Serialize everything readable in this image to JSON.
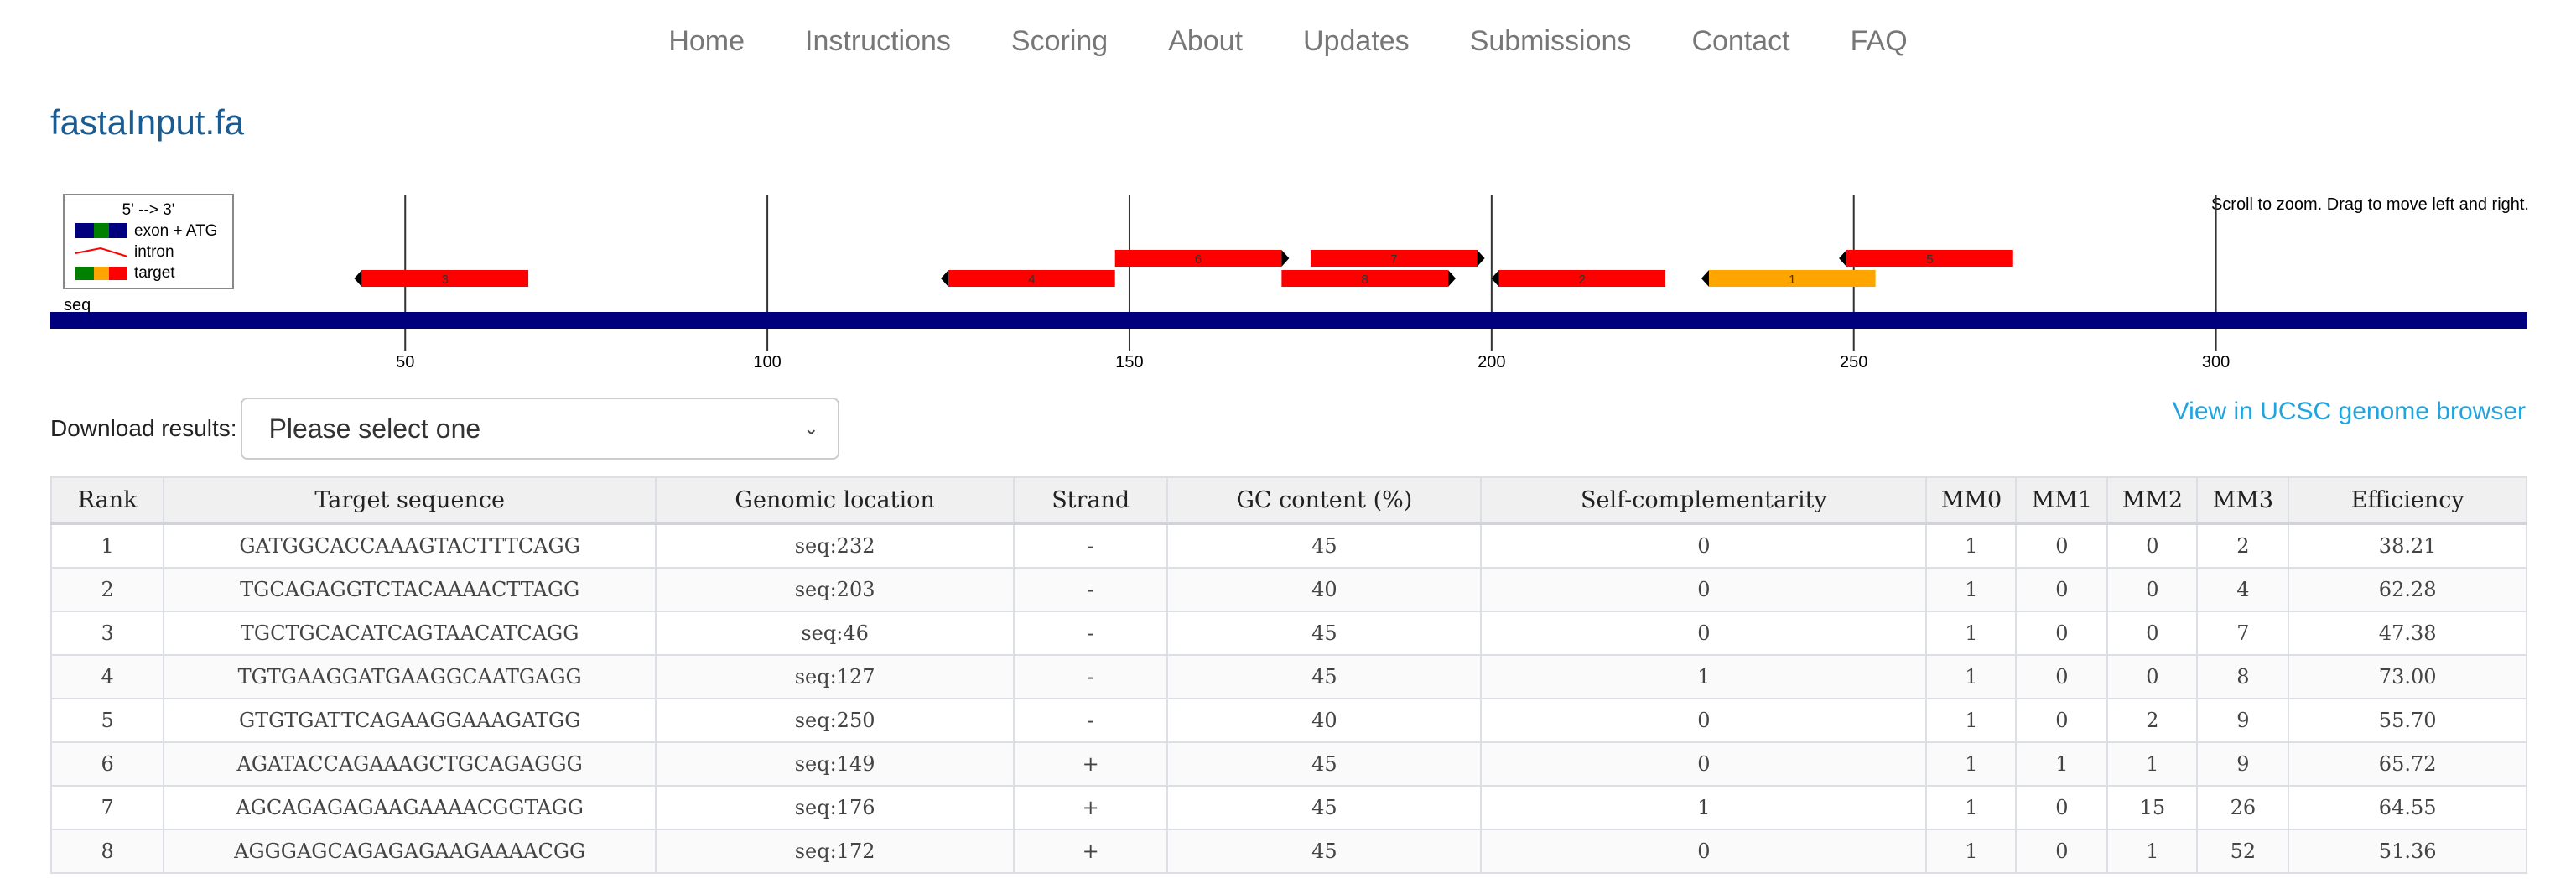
{
  "nav": {
    "items": [
      "Home",
      "Instructions",
      "Scoring",
      "About",
      "Updates",
      "Submissions",
      "Contact",
      "FAQ"
    ]
  },
  "page": {
    "title": "fastaInput.fa"
  },
  "viz": {
    "legend": {
      "direction": "5' --> 3'",
      "exon": "exon + ATG",
      "intron": "intron",
      "target": "target"
    },
    "hint": "Scroll to zoom. Drag to move left and right.",
    "sequence_label": "seq",
    "axis": {
      "min": 1,
      "max": 343,
      "ticks": [
        50,
        100,
        150,
        200,
        250,
        300
      ]
    },
    "colors": {
      "exon": "#00007f",
      "target_red": "#ff0000",
      "target_best": "#ffa500",
      "exon_green": "#008000",
      "legend_yellow": "#ffa500"
    },
    "targets": [
      {
        "label": "3",
        "start": 44,
        "end": 67,
        "strand": "-",
        "row": 1,
        "color": "#ff0000"
      },
      {
        "label": "4",
        "start": 125,
        "end": 148,
        "strand": "-",
        "row": 1,
        "color": "#ff0000"
      },
      {
        "label": "6",
        "start": 148,
        "end": 171,
        "strand": "+",
        "row": 0,
        "color": "#ff0000"
      },
      {
        "label": "7",
        "start": 175,
        "end": 198,
        "strand": "+",
        "row": 0,
        "color": "#ff0000"
      },
      {
        "label": "8",
        "start": 171,
        "end": 194,
        "strand": "+",
        "row": 1,
        "color": "#ff0000"
      },
      {
        "label": "2",
        "start": 201,
        "end": 224,
        "strand": "-",
        "row": 1,
        "color": "#ff0000"
      },
      {
        "label": "1",
        "start": 230,
        "end": 253,
        "strand": "-",
        "row": 1,
        "color": "#ffa500"
      },
      {
        "label": "5",
        "start": 249,
        "end": 272,
        "strand": "-",
        "row": 0,
        "color": "#ff0000"
      }
    ]
  },
  "download": {
    "label": "Download results:",
    "selected": "Please select one"
  },
  "ucsc_link": "View in UCSC genome browser",
  "table": {
    "headers": [
      "Rank",
      "Target sequence",
      "Genomic location",
      "Strand",
      "GC content (%)",
      "Self-complementarity",
      "MM0",
      "MM1",
      "MM2",
      "MM3",
      "Efficiency"
    ],
    "rows": [
      [
        "1",
        "GATGGCACCAAAGTACTTTCAGG",
        "seq:232",
        "-",
        "45",
        "0",
        "1",
        "0",
        "0",
        "2",
        "38.21"
      ],
      [
        "2",
        "TGCAGAGGTCTACAAAACTTAGG",
        "seq:203",
        "-",
        "40",
        "0",
        "1",
        "0",
        "0",
        "4",
        "62.28"
      ],
      [
        "3",
        "TGCTGCACATCAGTAACATCAGG",
        "seq:46",
        "-",
        "45",
        "0",
        "1",
        "0",
        "0",
        "7",
        "47.38"
      ],
      [
        "4",
        "TGTGAAGGATGAAGGCAATGAGG",
        "seq:127",
        "-",
        "45",
        "1",
        "1",
        "0",
        "0",
        "8",
        "73.00"
      ],
      [
        "5",
        "GTGTGATTCAGAAGGAAAGATGG",
        "seq:250",
        "-",
        "40",
        "0",
        "1",
        "0",
        "2",
        "9",
        "55.70"
      ],
      [
        "6",
        "AGATACCAGAAAGCTGCAGAGGG",
        "seq:149",
        "+",
        "45",
        "0",
        "1",
        "1",
        "1",
        "9",
        "65.72"
      ],
      [
        "7",
        "AGCAGAGAGAAGAAAACGGTAGG",
        "seq:176",
        "+",
        "45",
        "1",
        "1",
        "0",
        "15",
        "26",
        "64.55"
      ],
      [
        "8",
        "AGGGAGCAGAGAGAAGAAAACGG",
        "seq:172",
        "+",
        "45",
        "0",
        "1",
        "0",
        "1",
        "52",
        "51.36"
      ]
    ]
  }
}
